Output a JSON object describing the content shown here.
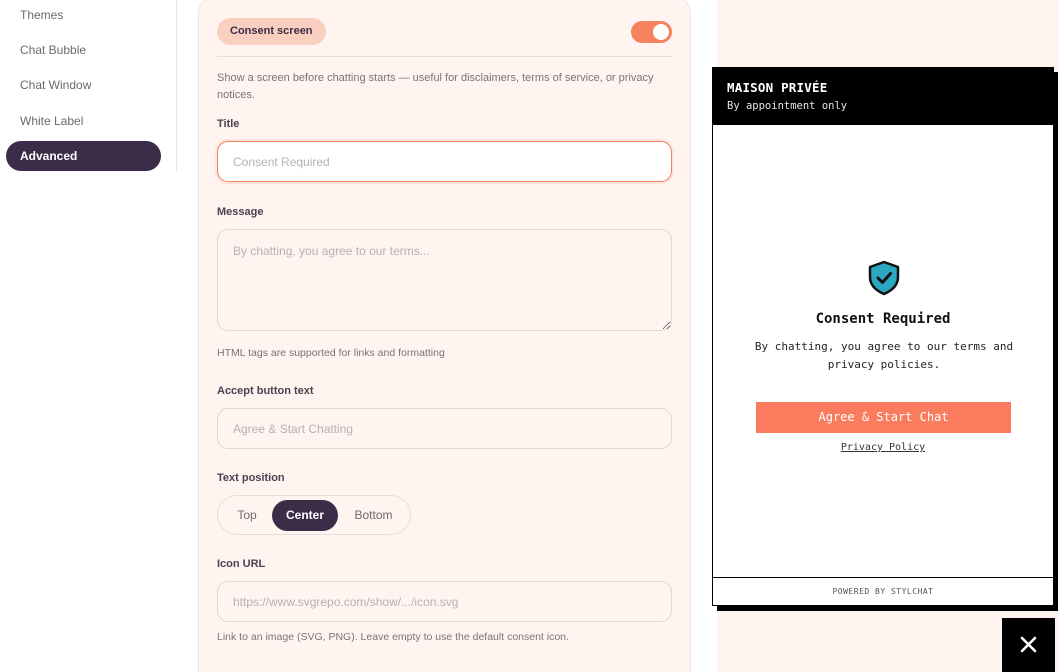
{
  "sidebar": {
    "items": [
      {
        "label": "Themes"
      },
      {
        "label": "Chat Bubble"
      },
      {
        "label": "Chat Window"
      },
      {
        "label": "White Label"
      },
      {
        "label": "Advanced"
      }
    ]
  },
  "consent": {
    "section_label": "Consent screen",
    "enabled": true,
    "description": "Show a screen before chatting starts — useful for disclaimers, terms of service, or privacy notices.",
    "title_label": "Title",
    "title_placeholder": "Consent Required",
    "message_label": "Message",
    "message_placeholder": "By chatting, you agree to our terms...",
    "message_help": "HTML tags are supported for links and formatting",
    "accept_label": "Accept button text",
    "accept_placeholder": "Agree & Start Chatting",
    "position_label": "Text position",
    "positions": [
      "Top",
      "Center",
      "Bottom"
    ],
    "selected_position": "Center",
    "icon_label": "Icon URL",
    "icon_placeholder": "https://www.svgrepo.com/show/.../icon.svg",
    "icon_help": "Link to an image (SVG, PNG). Leave empty to use the default consent icon."
  },
  "preview": {
    "brand": "MAISON PRIVÉE",
    "tagline": "By appointment only",
    "consent_title": "Consent Required",
    "consent_message": "By chatting, you agree to our terms and privacy policies.",
    "accept_button": "Agree & Start Chat",
    "privacy_link": "Privacy Policy",
    "footer": "POWERED BY STYLCHAT",
    "icon": "shield-check-icon"
  },
  "colors": {
    "accent": "#f4825f",
    "dark": "#3b2d48",
    "panel": "#fff4f0",
    "shield": "#2ba7c4"
  }
}
